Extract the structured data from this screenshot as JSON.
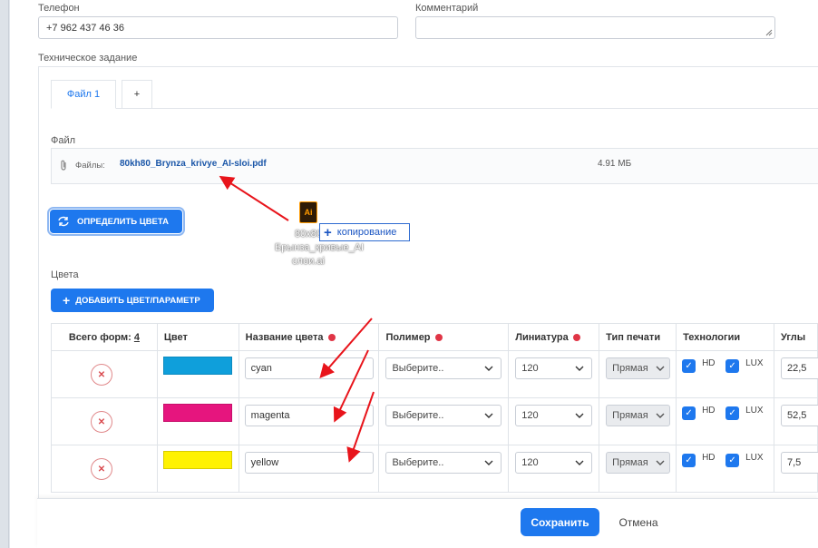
{
  "phone": {
    "label": "Телефон",
    "value": "+7 962 437 46 36"
  },
  "comment": {
    "label": "Комментарий",
    "value": ""
  },
  "tz": {
    "label": "Техническое задание",
    "tabs": [
      {
        "label": "Файл 1",
        "active": true
      },
      {
        "label": "+"
      }
    ]
  },
  "file": {
    "section_label": "Файл",
    "files_label": "Файлы:",
    "name": "80kh80_Brynza_krivye_AI-sloi.pdf",
    "size": "4.91 МБ"
  },
  "detect_button": "ОПРЕДЕЛИТЬ ЦВЕТА",
  "drag": {
    "icon_text": "Ai",
    "file_label": "80х80 Брынза_кривые_AI слои.ai",
    "tooltip": "копирование"
  },
  "colors_section": {
    "label": "Цвета",
    "add_button": "ДОБАВИТЬ ЦВЕТ/ПАРАМЕТР"
  },
  "table": {
    "headers": {
      "total_forms_label": "Всего форм:",
      "total_forms_count": "4",
      "color": "Цвет",
      "color_name": "Название цвета",
      "polymer": "Полимер",
      "lineature": "Линиатура",
      "print_type": "Тип печати",
      "technologies": "Технологии",
      "angles": "Углы"
    },
    "rows": [
      {
        "swatch": "#0f9fdb",
        "name": "cyan",
        "polymer": "Выберите..",
        "lineature": "120",
        "print_type": "Прямая",
        "hd": "HD",
        "lux": "LUX",
        "angle": "22,5"
      },
      {
        "swatch": "#e6157e",
        "name": "magenta",
        "polymer": "Выберите..",
        "lineature": "120",
        "print_type": "Прямая",
        "hd": "HD",
        "lux": "LUX",
        "angle": "52,5"
      },
      {
        "swatch": "#fff200",
        "name": "yellow",
        "polymer": "Выберите..",
        "lineature": "120",
        "print_type": "Прямая",
        "hd": "HD",
        "lux": "LUX",
        "angle": "7,5"
      }
    ]
  },
  "footer": {
    "save": "Сохранить",
    "cancel": "Отмена"
  },
  "colors": {
    "accent": "#1e78ee",
    "required_dot": "#e03546",
    "remove": "#d94a4e",
    "annotation_arrow": "#e8141b"
  }
}
